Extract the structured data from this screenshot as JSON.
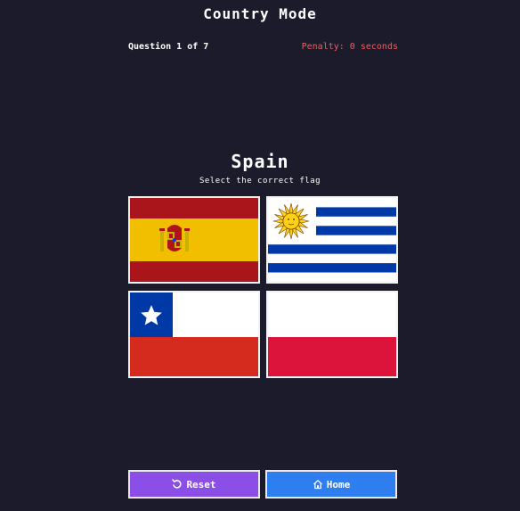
{
  "header": {
    "title": "Country Mode",
    "question_counter": "Question 1 of 7",
    "penalty": "Penalty: 0 seconds"
  },
  "prompt": {
    "country": "Spain",
    "instruction": "Select the correct flag"
  },
  "options": [
    {
      "flag": "spain",
      "icon": "spain-flag"
    },
    {
      "flag": "uruguay",
      "icon": "uruguay-flag"
    },
    {
      "flag": "chile",
      "icon": "chile-flag"
    },
    {
      "flag": "poland",
      "icon": "poland-flag"
    }
  ],
  "buttons": {
    "reset_label": "Reset",
    "reset_icon": "reset-icon",
    "home_label": "Home",
    "home_icon": "home-icon"
  },
  "colors": {
    "background": "#1b1b2b",
    "penalty_text": "#f25c5c",
    "reset_button": "#8b4fe8",
    "home_button": "#2f7ef0"
  }
}
